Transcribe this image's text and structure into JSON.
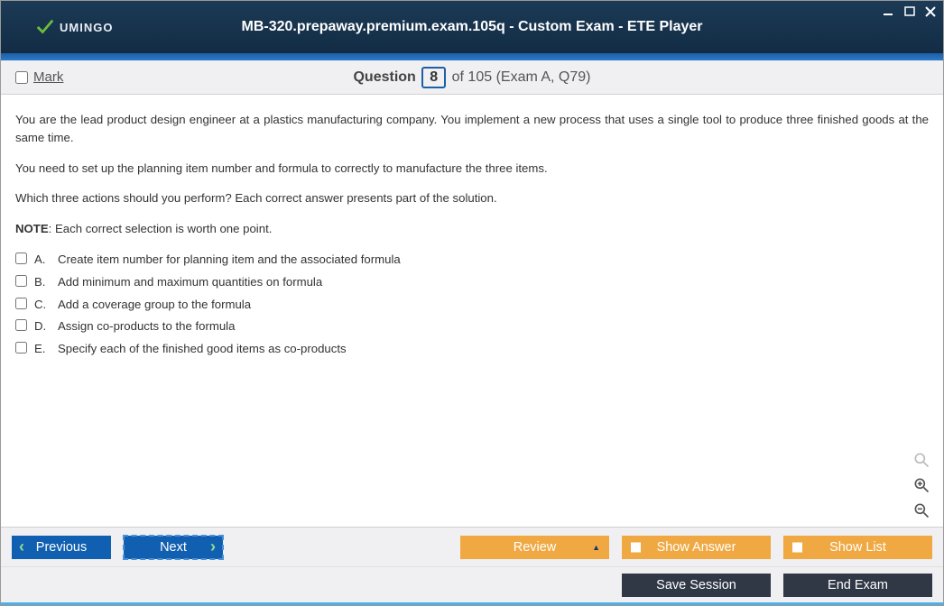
{
  "header": {
    "brand": "UMINGO",
    "title": "MB-320.prepaway.premium.exam.105q - Custom Exam - ETE Player"
  },
  "question_bar": {
    "mark_label": "Mark",
    "question_label": "Question",
    "current_number": "8",
    "total_text": "of 105 (Exam A, Q79)"
  },
  "question": {
    "para1": "You are the lead product design engineer at a plastics manufacturing company. You implement a new process that uses a single tool to produce three finished goods at the same time.",
    "para2": "You need to set up the planning item number and formula to correctly to manufacture the three items.",
    "para3": "Which three actions should you perform? Each correct answer presents part of the solution.",
    "note_label": "NOTE",
    "note_text": ": Each correct selection is worth one point.",
    "answers": [
      {
        "letter": "A.",
        "text": "Create item number for planning item and the associated formula"
      },
      {
        "letter": "B.",
        "text": "Add minimum and maximum quantities on formula"
      },
      {
        "letter": "C.",
        "text": "Add a coverage group to the formula"
      },
      {
        "letter": "D.",
        "text": "Assign co-products to the formula"
      },
      {
        "letter": "E.",
        "text": "Specify each of the finished good items as co-products"
      }
    ]
  },
  "footer": {
    "previous": "Previous",
    "next": "Next",
    "review": "Review",
    "show_answer": "Show Answer",
    "show_list": "Show List",
    "save_session": "Save Session",
    "end_exam": "End Exam"
  }
}
